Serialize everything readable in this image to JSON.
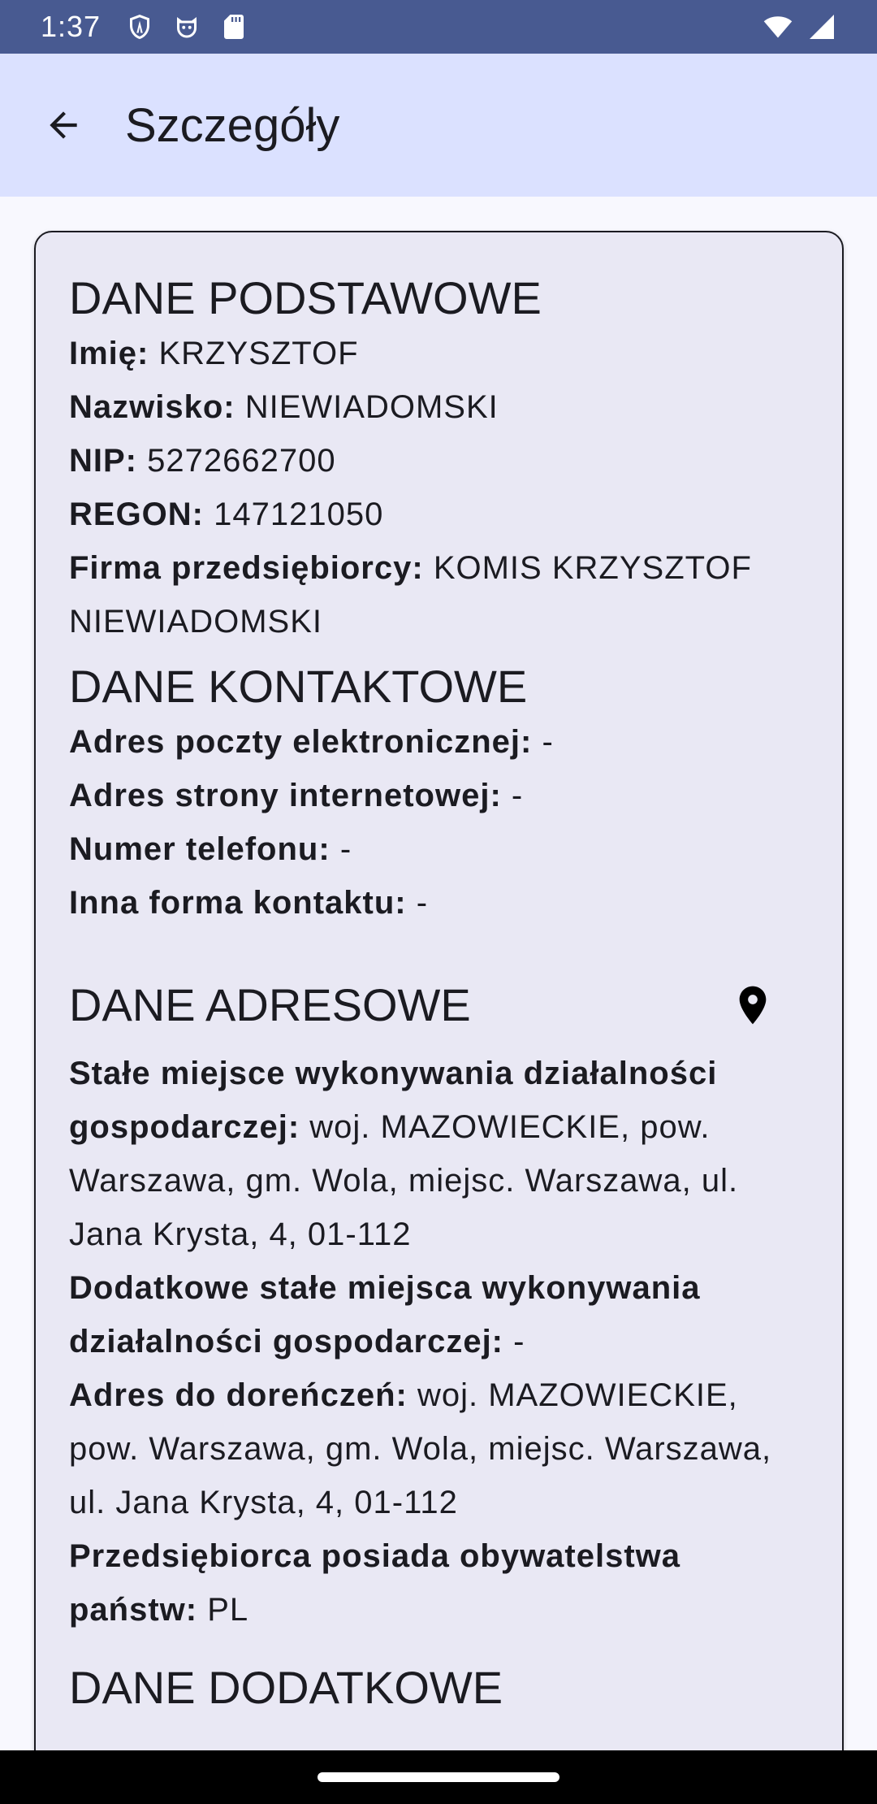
{
  "status_bar": {
    "time": "1:37",
    "left_icons": [
      "shield-icon",
      "cat-icon",
      "sd-card-icon"
    ],
    "right_icons": [
      "wifi-icon",
      "signal-icon"
    ]
  },
  "app_bar": {
    "back_icon": "arrow-back-icon",
    "title": "Szczegóły"
  },
  "basic": {
    "title": "DANE PODSTAWOWE",
    "fields": [
      {
        "label": "Imię:",
        "value": "KRZYSZTOF"
      },
      {
        "label": "Nazwisko:",
        "value": "NIEWIADOMSKI"
      },
      {
        "label": "NIP:",
        "value": "5272662700"
      },
      {
        "label": "REGON:",
        "value": "147121050"
      },
      {
        "label": "Firma przedsiębiorcy:",
        "value": "KOMIS KRZYSZTOF NIEWIADOMSKI"
      }
    ]
  },
  "contact": {
    "title": "DANE KONTAKTOWE",
    "fields": [
      {
        "label": "Adres poczty elektronicznej:",
        "value": "-"
      },
      {
        "label": "Adres strony internetowej:",
        "value": "-"
      },
      {
        "label": "Numer telefonu:",
        "value": "-"
      },
      {
        "label": "Inna forma kontaktu:",
        "value": "-"
      }
    ]
  },
  "address": {
    "title": "DANE ADRESOWE",
    "map_icon": "location-pin-icon",
    "fields": [
      {
        "label": "Stałe miejsce wykonywania działalności gospodarczej:",
        "value": "woj. MAZOWIECKIE, pow. Warszawa, gm. Wola, miejsc. Warszawa, ul. Jana Krysta, 4, 01-112"
      },
      {
        "label": "Dodatkowe stałe miejsca wykonywania działalności gospodarczej:",
        "value": "-"
      },
      {
        "label": "Adres do doreńczeń:",
        "value": "woj. MAZOWIECKIE, pow. Warszawa, gm. Wola, miejsc. Warszawa, ul. Jana Krysta, 4, 01-112"
      },
      {
        "label": "Przedsiębiorca posiada obywatelstwa państw:",
        "value": "PL"
      }
    ]
  },
  "additional": {
    "title": "DANE DODATKOWE"
  },
  "colors": {
    "status_bar": "#485a91",
    "app_bar": "#dbe1ff",
    "card": "#e9e8f4",
    "background": "#f8f8fe"
  }
}
